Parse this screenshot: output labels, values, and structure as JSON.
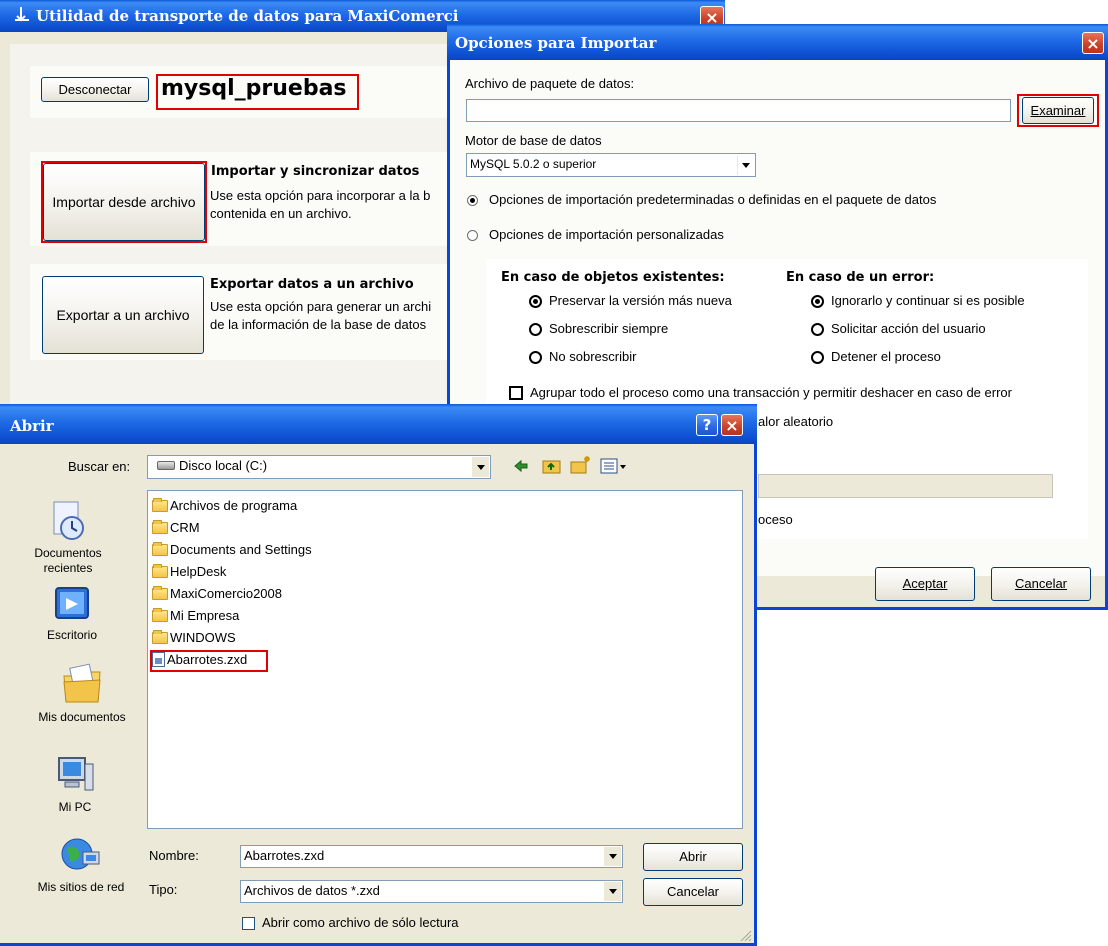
{
  "main_window": {
    "title": "Utilidad de transporte de datos para MaxiComerci",
    "disconnect_label": "Desconectar",
    "connection_name": "mysql_pruebas",
    "import_button_label": "Importar desde archivo",
    "import_heading": "Importar y sincronizar datos",
    "import_desc": "Use esta opción para incorporar a la b contenida en un archivo.",
    "export_button_label": "Exportar a un archivo",
    "export_heading": "Exportar datos a un archivo",
    "export_desc": "Use esta opción para generar un archi de la información de la base de datos"
  },
  "import_options": {
    "title": "Opciones para Importar",
    "package_label": "Archivo de paquete de datos:",
    "package_value": "",
    "browse_label": "Examinar",
    "engine_label": "Motor de base de datos",
    "engine_value": "MySQL 5.0.2 o superior",
    "radio_default": "Opciones de importación predeterminadas o definidas en el paquete de datos",
    "radio_custom": "Opciones de importación personalizadas",
    "existing_heading": "En caso de objetos existentes:",
    "existing_options": [
      "Preservar la versión  más nueva",
      "Sobrescribir siempre",
      "No sobrescribir"
    ],
    "error_heading": "En caso de un error:",
    "error_options": [
      "Ignorarlo y continuar si es posible",
      "Solicitar acción del usuario",
      "Detener el proceso"
    ],
    "transaction_label": "Agrupar todo el proceso como una transacción y permitir deshacer en caso de error",
    "partial_random": "alor aleatorio",
    "partial_process": "oceso",
    "accept_label": "Aceptar",
    "cancel_label": "Cancelar"
  },
  "open_dialog": {
    "title": "Abrir",
    "look_in_label": "Buscar en:",
    "look_in_value": "Disco local (C:)",
    "places": [
      "Documentos recientes",
      "Escritorio",
      "Mis documentos",
      "Mi PC",
      "Mis sitios de red"
    ],
    "files": [
      "Archivos de programa",
      "CRM",
      "Documents and Settings",
      "HelpDesk",
      "MaxiComercio2008",
      "Mi Empresa",
      "WINDOWS",
      "Abarrotes.zxd"
    ],
    "name_label": "Nombre:",
    "name_value": "Abarrotes.zxd",
    "type_label": "Tipo:",
    "type_value": "Archivos de datos *.zxd",
    "readonly_label": "Abrir como archivo de sólo lectura",
    "open_label": "Abrir",
    "cancel_label": "Cancelar"
  }
}
